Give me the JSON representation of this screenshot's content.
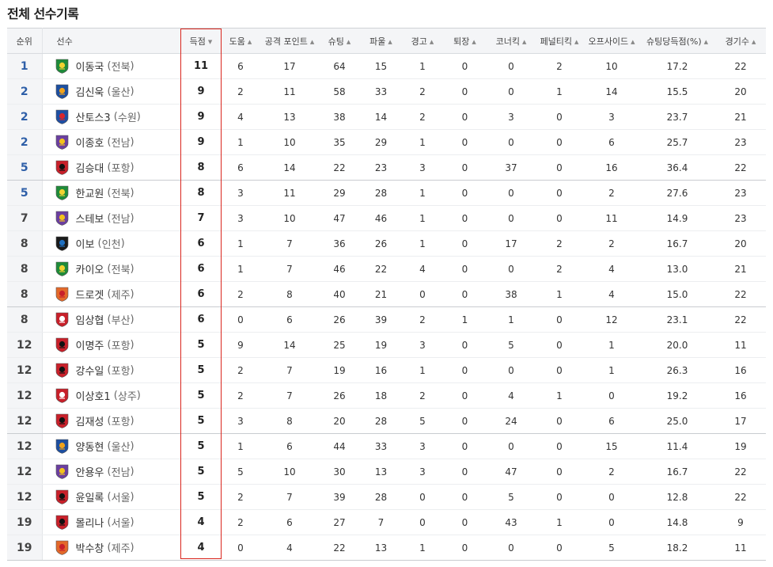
{
  "title": "전체 선수기록",
  "headers": [
    {
      "key": "rank",
      "label": "순위",
      "sort": ""
    },
    {
      "key": "player",
      "label": "선수",
      "sort": ""
    },
    {
      "key": "goals",
      "label": "득점",
      "sort": "▼"
    },
    {
      "key": "assists",
      "label": "도움",
      "sort": "▲"
    },
    {
      "key": "attack_points",
      "label": "공격 포인트",
      "sort": "▲"
    },
    {
      "key": "shots",
      "label": "슈팅",
      "sort": "▲"
    },
    {
      "key": "fouls",
      "label": "파울",
      "sort": "▲"
    },
    {
      "key": "yellow",
      "label": "경고",
      "sort": "▲"
    },
    {
      "key": "red",
      "label": "퇴장",
      "sort": "▲"
    },
    {
      "key": "corners",
      "label": "코너킥",
      "sort": "▲"
    },
    {
      "key": "penalties",
      "label": "페널티킥",
      "sort": "▲"
    },
    {
      "key": "offsides",
      "label": "오프사이드",
      "sort": "▲"
    },
    {
      "key": "conversion",
      "label": "슈팅당득점(%)",
      "sort": "▲"
    },
    {
      "key": "games",
      "label": "경기수",
      "sort": "▲"
    }
  ],
  "team_colors": {
    "전북": {
      "primary": "#1f8b3a",
      "secondary": "#f2d230"
    },
    "울산": {
      "primary": "#1d4fa0",
      "secondary": "#f0a21a"
    },
    "수원": {
      "primary": "#1e4fa3",
      "secondary": "#d9262c"
    },
    "전남": {
      "primary": "#6b3fa0",
      "secondary": "#f2c21b"
    },
    "포항": {
      "primary": "#c8202a",
      "secondary": "#111111"
    },
    "인천": {
      "primary": "#1a1a1a",
      "secondary": "#1e6fc0"
    },
    "제주": {
      "primary": "#e3692a",
      "secondary": "#c8202a"
    },
    "부산": {
      "primary": "#c8202a",
      "secondary": "#ffffff"
    },
    "상주": {
      "primary": "#c8202a",
      "secondary": "#ffffff"
    },
    "서울": {
      "primary": "#c8202a",
      "secondary": "#111111"
    }
  },
  "rows": [
    {
      "rank": "1",
      "top": true,
      "name": "이동국",
      "team": "전북",
      "goals": "11",
      "assists": "6",
      "attack_points": "17",
      "shots": "64",
      "fouls": "15",
      "yellow": "1",
      "red": "0",
      "corners": "0",
      "penalties": "2",
      "offsides": "10",
      "conversion": "17.2",
      "games": "22"
    },
    {
      "rank": "2",
      "top": true,
      "name": "김신욱",
      "team": "울산",
      "goals": "9",
      "assists": "2",
      "attack_points": "11",
      "shots": "58",
      "fouls": "33",
      "yellow": "2",
      "red": "0",
      "corners": "0",
      "penalties": "1",
      "offsides": "14",
      "conversion": "15.5",
      "games": "20"
    },
    {
      "rank": "2",
      "top": true,
      "name": "산토스3",
      "team": "수원",
      "goals": "9",
      "assists": "4",
      "attack_points": "13",
      "shots": "38",
      "fouls": "14",
      "yellow": "2",
      "red": "0",
      "corners": "3",
      "penalties": "0",
      "offsides": "3",
      "conversion": "23.7",
      "games": "21"
    },
    {
      "rank": "2",
      "top": true,
      "name": "이종호",
      "team": "전남",
      "goals": "9",
      "assists": "1",
      "attack_points": "10",
      "shots": "35",
      "fouls": "29",
      "yellow": "1",
      "red": "0",
      "corners": "0",
      "penalties": "0",
      "offsides": "6",
      "conversion": "25.7",
      "games": "23"
    },
    {
      "rank": "5",
      "top": true,
      "name": "김승대",
      "team": "포항",
      "goals": "8",
      "assists": "6",
      "attack_points": "14",
      "shots": "22",
      "fouls": "23",
      "yellow": "3",
      "red": "0",
      "corners": "37",
      "penalties": "0",
      "offsides": "16",
      "conversion": "36.4",
      "games": "22"
    },
    {
      "rank": "5",
      "top": true,
      "name": "한교원",
      "team": "전북",
      "goals": "8",
      "assists": "3",
      "attack_points": "11",
      "shots": "29",
      "fouls": "28",
      "yellow": "1",
      "red": "0",
      "corners": "0",
      "penalties": "0",
      "offsides": "2",
      "conversion": "27.6",
      "games": "23"
    },
    {
      "rank": "7",
      "top": false,
      "name": "스테보",
      "team": "전남",
      "goals": "7",
      "assists": "3",
      "attack_points": "10",
      "shots": "47",
      "fouls": "46",
      "yellow": "1",
      "red": "0",
      "corners": "0",
      "penalties": "0",
      "offsides": "11",
      "conversion": "14.9",
      "games": "23"
    },
    {
      "rank": "8",
      "top": false,
      "name": "이보",
      "team": "인천",
      "goals": "6",
      "assists": "1",
      "attack_points": "7",
      "shots": "36",
      "fouls": "26",
      "yellow": "1",
      "red": "0",
      "corners": "17",
      "penalties": "2",
      "offsides": "2",
      "conversion": "16.7",
      "games": "20"
    },
    {
      "rank": "8",
      "top": false,
      "name": "카이오",
      "team": "전북",
      "goals": "6",
      "assists": "1",
      "attack_points": "7",
      "shots": "46",
      "fouls": "22",
      "yellow": "4",
      "red": "0",
      "corners": "0",
      "penalties": "2",
      "offsides": "4",
      "conversion": "13.0",
      "games": "21"
    },
    {
      "rank": "8",
      "top": false,
      "name": "드로겟",
      "team": "제주",
      "goals": "6",
      "assists": "2",
      "attack_points": "8",
      "shots": "40",
      "fouls": "21",
      "yellow": "0",
      "red": "0",
      "corners": "38",
      "penalties": "1",
      "offsides": "4",
      "conversion": "15.0",
      "games": "22"
    },
    {
      "rank": "8",
      "top": false,
      "name": "임상협",
      "team": "부산",
      "goals": "6",
      "assists": "0",
      "attack_points": "6",
      "shots": "26",
      "fouls": "39",
      "yellow": "2",
      "red": "1",
      "corners": "1",
      "penalties": "0",
      "offsides": "12",
      "conversion": "23.1",
      "games": "22"
    },
    {
      "rank": "12",
      "top": false,
      "name": "이명주",
      "team": "포항",
      "goals": "5",
      "assists": "9",
      "attack_points": "14",
      "shots": "25",
      "fouls": "19",
      "yellow": "3",
      "red": "0",
      "corners": "5",
      "penalties": "0",
      "offsides": "1",
      "conversion": "20.0",
      "games": "11"
    },
    {
      "rank": "12",
      "top": false,
      "name": "강수일",
      "team": "포항",
      "goals": "5",
      "assists": "2",
      "attack_points": "7",
      "shots": "19",
      "fouls": "16",
      "yellow": "1",
      "red": "0",
      "corners": "0",
      "penalties": "0",
      "offsides": "1",
      "conversion": "26.3",
      "games": "16"
    },
    {
      "rank": "12",
      "top": false,
      "name": "이상호1",
      "team": "상주",
      "goals": "5",
      "assists": "2",
      "attack_points": "7",
      "shots": "26",
      "fouls": "18",
      "yellow": "2",
      "red": "0",
      "corners": "4",
      "penalties": "1",
      "offsides": "0",
      "conversion": "19.2",
      "games": "16"
    },
    {
      "rank": "12",
      "top": false,
      "name": "김재성",
      "team": "포항",
      "goals": "5",
      "assists": "3",
      "attack_points": "8",
      "shots": "20",
      "fouls": "28",
      "yellow": "5",
      "red": "0",
      "corners": "24",
      "penalties": "0",
      "offsides": "6",
      "conversion": "25.0",
      "games": "17"
    },
    {
      "rank": "12",
      "top": false,
      "name": "양동현",
      "team": "울산",
      "goals": "5",
      "assists": "1",
      "attack_points": "6",
      "shots": "44",
      "fouls": "33",
      "yellow": "3",
      "red": "0",
      "corners": "0",
      "penalties": "0",
      "offsides": "15",
      "conversion": "11.4",
      "games": "19"
    },
    {
      "rank": "12",
      "top": false,
      "name": "안용우",
      "team": "전남",
      "goals": "5",
      "assists": "5",
      "attack_points": "10",
      "shots": "30",
      "fouls": "13",
      "yellow": "3",
      "red": "0",
      "corners": "47",
      "penalties": "0",
      "offsides": "2",
      "conversion": "16.7",
      "games": "22"
    },
    {
      "rank": "12",
      "top": false,
      "name": "윤일록",
      "team": "서울",
      "goals": "5",
      "assists": "2",
      "attack_points": "7",
      "shots": "39",
      "fouls": "28",
      "yellow": "0",
      "red": "0",
      "corners": "5",
      "penalties": "0",
      "offsides": "0",
      "conversion": "12.8",
      "games": "22"
    },
    {
      "rank": "19",
      "top": false,
      "name": "몰리나",
      "team": "서울",
      "goals": "4",
      "assists": "2",
      "attack_points": "6",
      "shots": "27",
      "fouls": "7",
      "yellow": "0",
      "red": "0",
      "corners": "43",
      "penalties": "1",
      "offsides": "0",
      "conversion": "14.8",
      "games": "9"
    },
    {
      "rank": "19",
      "top": false,
      "name": "박수창",
      "team": "제주",
      "goals": "4",
      "assists": "0",
      "attack_points": "4",
      "shots": "22",
      "fouls": "13",
      "yellow": "1",
      "red": "0",
      "corners": "0",
      "penalties": "0",
      "offsides": "5",
      "conversion": "18.2",
      "games": "11"
    }
  ]
}
